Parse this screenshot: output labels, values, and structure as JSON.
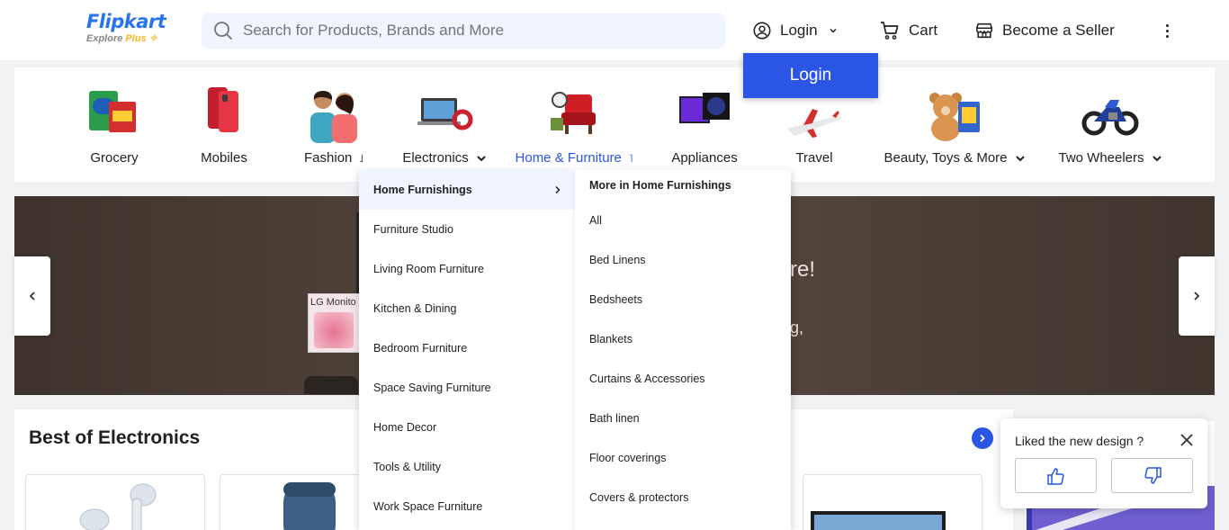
{
  "header": {
    "logo_main": "Flipkart",
    "logo_sub": "Explore",
    "logo_plus": "Plus",
    "search_placeholder": "Search for Products, Brands and More",
    "login_label": "Login",
    "cart_label": "Cart",
    "seller_label": "Become a Seller",
    "login_popup_label": "Login"
  },
  "categories": [
    {
      "label": "Grocery",
      "icon": "grocery-icon",
      "has_chevron": false
    },
    {
      "label": "Mobiles",
      "icon": "mobile-icon",
      "has_chevron": false
    },
    {
      "label": "Fashion",
      "icon": "fashion-icon",
      "has_chevron": true
    },
    {
      "label": "Electronics",
      "icon": "laptop-icon",
      "has_chevron": true
    },
    {
      "label": "Home & Furniture",
      "icon": "furniture-icon",
      "has_chevron": true,
      "active": true
    },
    {
      "label": "Appliances",
      "icon": "tv-icon",
      "has_chevron": false
    },
    {
      "label": "Travel",
      "icon": "airplane-icon",
      "has_chevron": false
    },
    {
      "label": "Beauty, Toys & More",
      "icon": "teddy-icon",
      "has_chevron": true
    },
    {
      "label": "Two Wheelers",
      "icon": "motorbike-icon",
      "has_chevron": true
    }
  ],
  "banner": {
    "lg_text": "LG Monito",
    "partial_text_1": "re!",
    "partial_text_2": "g,"
  },
  "menu_left": [
    "Home Furnishings",
    "Furniture Studio",
    "Living Room Furniture",
    "Kitchen & Dining",
    "Bedroom Furniture",
    "Space Saving Furniture",
    "Home Decor",
    "Tools & Utility",
    "Work Space Furniture"
  ],
  "menu_right": {
    "heading": "More in Home Furnishings",
    "items": [
      "All",
      "Bed Linens",
      "Bedsheets",
      "Blankets",
      "Curtains & Accessories",
      "Bath linen",
      "Floor coverings",
      "Covers & protectors"
    ]
  },
  "section": {
    "title": "Best of Electronics"
  },
  "feedback": {
    "title": "Liked the new design ?"
  },
  "colors": {
    "brand_blue": "#2874f0",
    "accent_blue": "#2a55e5",
    "plus_yellow": "#f8b91e"
  }
}
